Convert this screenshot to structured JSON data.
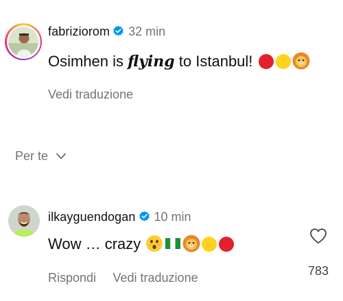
{
  "comment1": {
    "username": "fabriziorom",
    "time": "32 min",
    "text_before": "Osimhen is ",
    "text_italic": "flying",
    "text_after": " to Istanbul!",
    "translate_label": "Vedi traduzione",
    "emojis": [
      "red-circle-emoji",
      "yellow-circle-emoji",
      "lion-face-emoji"
    ]
  },
  "filter": {
    "label": "Per te"
  },
  "comment2": {
    "username": "ilkayguendogan",
    "time": "10 min",
    "text": "Wow … crazy",
    "reply_label": "Rispondi",
    "translate_label": "Vedi traduzione",
    "like_count": "783",
    "emojis": [
      "astonished-face-emoji",
      "nigeria-flag-emoji",
      "lion-face-emoji",
      "yellow-circle-emoji",
      "red-circle-emoji"
    ]
  },
  "colors": {
    "verified_blue": "#0095f6",
    "secondary_text": "#737373",
    "emoji_red": "#e3202b",
    "emoji_yellow": "#ffd21e"
  }
}
